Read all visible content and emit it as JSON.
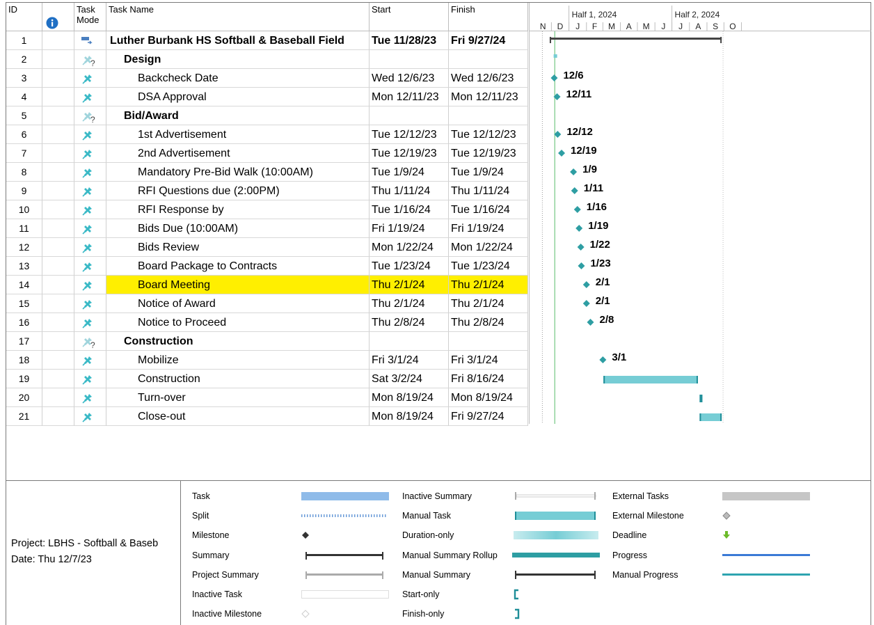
{
  "headers": {
    "id": "ID",
    "task_mode": "Task Mode",
    "task_mode_l1": "Task",
    "task_mode_l2": "Mode",
    "task_name": "Task Name",
    "start": "Start",
    "finish": "Finish"
  },
  "timescale": {
    "top": [
      {
        "label": "Half 1, 2024"
      },
      {
        "label": "Half 2, 2024"
      }
    ],
    "months": [
      "N",
      "D",
      "J",
      "F",
      "M",
      "A",
      "M",
      "J",
      "J",
      "A",
      "S",
      "O"
    ]
  },
  "tasks": [
    {
      "id": "1",
      "name": "Luther Burbank HS Softball & Baseball Field",
      "start": "Tue 11/28/23",
      "finish": "Fri 9/27/24",
      "level": 0,
      "bold": true,
      "mode": "summary"
    },
    {
      "id": "2",
      "name": "Design",
      "start": "",
      "finish": "",
      "level": 1,
      "bold": true,
      "mode": "unsched"
    },
    {
      "id": "3",
      "name": "Backcheck Date",
      "start": "Wed 12/6/23",
      "finish": "Wed 12/6/23",
      "level": 2,
      "mode": "manual"
    },
    {
      "id": "4",
      "name": "DSA Approval",
      "start": "Mon 12/11/23",
      "finish": "Mon 12/11/23",
      "level": 2,
      "mode": "manual"
    },
    {
      "id": "5",
      "name": "Bid/Award",
      "start": "",
      "finish": "",
      "level": 1,
      "bold": true,
      "mode": "unsched"
    },
    {
      "id": "6",
      "name": "1st Advertisement",
      "start": "Tue 12/12/23",
      "finish": "Tue 12/12/23",
      "level": 2,
      "mode": "manual"
    },
    {
      "id": "7",
      "name": "2nd Advertisement",
      "start": "Tue 12/19/23",
      "finish": "Tue 12/19/23",
      "level": 2,
      "mode": "manual"
    },
    {
      "id": "8",
      "name": "Mandatory Pre-Bid Walk (10:00AM)",
      "start": "Tue 1/9/24",
      "finish": "Tue 1/9/24",
      "level": 2,
      "mode": "manual"
    },
    {
      "id": "9",
      "name": "RFI Questions due (2:00PM)",
      "start": "Thu 1/11/24",
      "finish": "Thu 1/11/24",
      "level": 2,
      "mode": "manual"
    },
    {
      "id": "10",
      "name": "RFI Response by",
      "start": "Tue 1/16/24",
      "finish": "Tue 1/16/24",
      "level": 2,
      "mode": "manual"
    },
    {
      "id": "11",
      "name": "Bids Due (10:00AM)",
      "start": "Fri 1/19/24",
      "finish": "Fri 1/19/24",
      "level": 2,
      "mode": "manual"
    },
    {
      "id": "12",
      "name": "Bids Review",
      "start": "Mon 1/22/24",
      "finish": "Mon 1/22/24",
      "level": 2,
      "mode": "manual"
    },
    {
      "id": "13",
      "name": "Board Package to Contracts",
      "start": "Tue 1/23/24",
      "finish": "Tue 1/23/24",
      "level": 2,
      "mode": "manual"
    },
    {
      "id": "14",
      "name": "Board Meeting",
      "start": "Thu 2/1/24",
      "finish": "Thu 2/1/24",
      "level": 2,
      "mode": "manual",
      "highlight": true
    },
    {
      "id": "15",
      "name": "Notice of Award",
      "start": "Thu 2/1/24",
      "finish": "Thu 2/1/24",
      "level": 2,
      "mode": "manual"
    },
    {
      "id": "16",
      "name": "Notice to Proceed",
      "start": "Thu 2/8/24",
      "finish": "Thu 2/8/24",
      "level": 2,
      "mode": "manual"
    },
    {
      "id": "17",
      "name": "Construction",
      "start": "",
      "finish": "",
      "level": 1,
      "bold": true,
      "mode": "unsched"
    },
    {
      "id": "18",
      "name": "Mobilize",
      "start": "Fri 3/1/24",
      "finish": "Fri 3/1/24",
      "level": 2,
      "mode": "manual"
    },
    {
      "id": "19",
      "name": "Construction",
      "start": "Sat 3/2/24",
      "finish": "Fri 8/16/24",
      "level": 2,
      "mode": "manual"
    },
    {
      "id": "20",
      "name": "Turn-over",
      "start": "Mon 8/19/24",
      "finish": "Mon 8/19/24",
      "level": 2,
      "mode": "manual"
    },
    {
      "id": "21",
      "name": "Close-out",
      "start": "Mon 8/19/24",
      "finish": "Fri 9/27/24",
      "level": 2,
      "mode": "manual"
    }
  ],
  "gantt": {
    "colors": {
      "milestone": "#2e9ea3",
      "manual_task": "#76cdd5",
      "summary": "#444444",
      "today": "#7ecb8c"
    },
    "bars": [
      {
        "row": 1,
        "kind": "summary",
        "start": "2023-11-28",
        "end": "2024-09-27"
      },
      {
        "row": 2,
        "kind": "mini",
        "start": "2023-12-05",
        "end": "2023-12-07"
      },
      {
        "row": 3,
        "kind": "milestone",
        "date": "2023-12-06",
        "label": "12/6"
      },
      {
        "row": 4,
        "kind": "milestone",
        "date": "2023-12-11",
        "label": "12/11"
      },
      {
        "row": 6,
        "kind": "milestone",
        "date": "2023-12-12",
        "label": "12/12"
      },
      {
        "row": 7,
        "kind": "milestone",
        "date": "2023-12-19",
        "label": "12/19"
      },
      {
        "row": 8,
        "kind": "milestone",
        "date": "2024-01-09",
        "label": "1/9"
      },
      {
        "row": 9,
        "kind": "milestone",
        "date": "2024-01-11",
        "label": "1/11"
      },
      {
        "row": 10,
        "kind": "milestone",
        "date": "2024-01-16",
        "label": "1/16"
      },
      {
        "row": 11,
        "kind": "milestone",
        "date": "2024-01-19",
        "label": "1/19"
      },
      {
        "row": 12,
        "kind": "milestone",
        "date": "2024-01-22",
        "label": "1/22"
      },
      {
        "row": 13,
        "kind": "milestone",
        "date": "2024-01-23",
        "label": "1/23"
      },
      {
        "row": 14,
        "kind": "milestone",
        "date": "2024-02-01",
        "label": "2/1"
      },
      {
        "row": 15,
        "kind": "milestone",
        "date": "2024-02-01",
        "label": "2/1"
      },
      {
        "row": 16,
        "kind": "milestone",
        "date": "2024-02-08",
        "label": "2/8"
      },
      {
        "row": 18,
        "kind": "milestone",
        "date": "2024-03-01",
        "label": "3/1"
      },
      {
        "row": 19,
        "kind": "manual",
        "start": "2024-03-02",
        "end": "2024-08-16"
      },
      {
        "row": 20,
        "kind": "manual",
        "start": "2024-08-19",
        "end": "2024-08-20"
      },
      {
        "row": 21,
        "kind": "manual",
        "start": "2024-08-19",
        "end": "2024-09-27"
      }
    ],
    "today": "2023-12-07"
  },
  "footer": {
    "project": "Project: LBHS - Softball & Baseb",
    "date": "Date: Thu 12/7/23",
    "legend": [
      {
        "label": "Task",
        "icon": "task-bar"
      },
      {
        "label": "Split",
        "icon": "split-dots"
      },
      {
        "label": "Milestone",
        "icon": "milestone-diamond"
      },
      {
        "label": "Summary",
        "icon": "summary-bar"
      },
      {
        "label": "Project Summary",
        "icon": "project-summary-bar"
      },
      {
        "label": "Inactive Task",
        "icon": "inactive-task-bar"
      },
      {
        "label": "Inactive Milestone",
        "icon": "inactive-milestone-diamond"
      },
      {
        "label": "Inactive Summary",
        "icon": "inactive-summary-bar"
      },
      {
        "label": "Manual Task",
        "icon": "manual-task-bar"
      },
      {
        "label": "Duration-only",
        "icon": "duration-only-bar"
      },
      {
        "label": "Manual Summary Rollup",
        "icon": "manual-summary-rollup-bar"
      },
      {
        "label": "Manual Summary",
        "icon": "manual-summary-bar"
      },
      {
        "label": "Start-only",
        "icon": "start-only-bracket"
      },
      {
        "label": "Finish-only",
        "icon": "finish-only-bracket"
      },
      {
        "label": "External Tasks",
        "icon": "external-tasks-bar"
      },
      {
        "label": "External Milestone",
        "icon": "external-milestone-diamond"
      },
      {
        "label": "Deadline",
        "icon": "deadline-arrow"
      },
      {
        "label": "Progress",
        "icon": "progress-line"
      },
      {
        "label": "Manual Progress",
        "icon": "manual-progress-line"
      }
    ]
  }
}
